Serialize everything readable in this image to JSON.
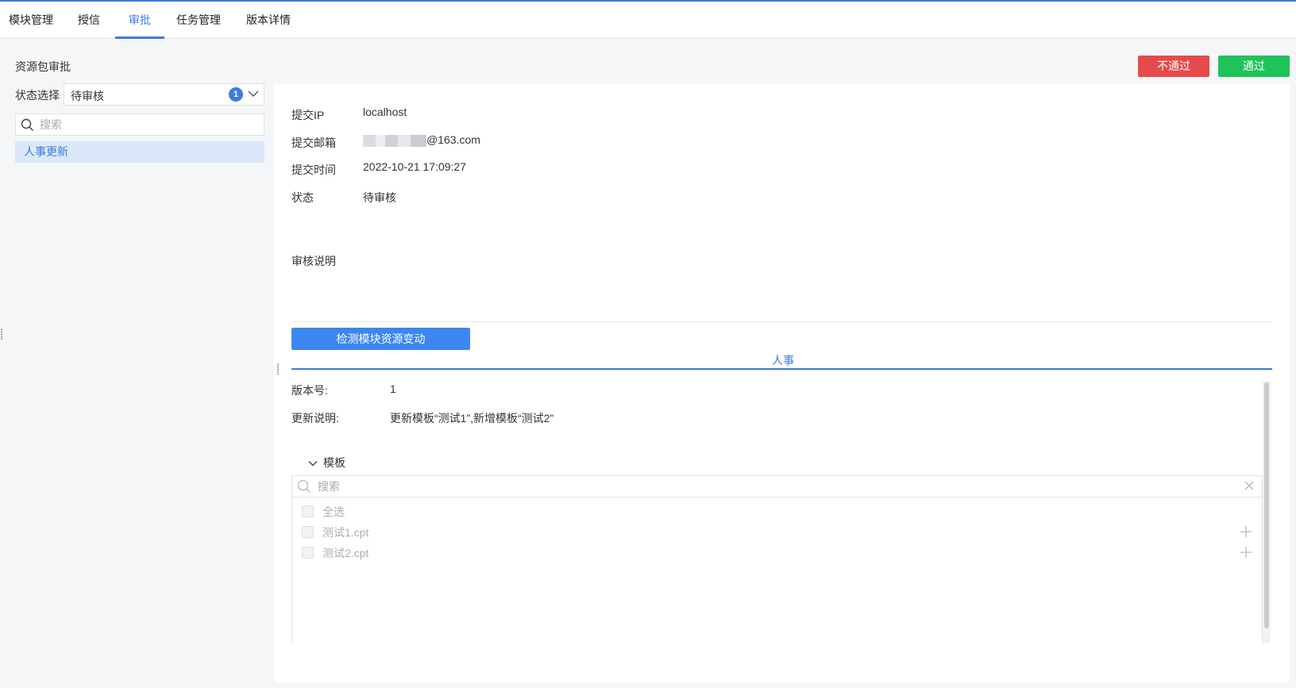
{
  "tabs": [
    {
      "label": "模块管理"
    },
    {
      "label": "授信"
    },
    {
      "label": "审批"
    },
    {
      "label": "任务管理"
    },
    {
      "label": "版本详情"
    }
  ],
  "active_tab": "审批",
  "left": {
    "title": "资源包审批",
    "status_label": "状态选择",
    "status_value": "待审核",
    "status_count": "1",
    "search_placeholder": "搜索",
    "items": [
      "人事更新"
    ]
  },
  "actions": {
    "reject": "不通过",
    "pass": "通过"
  },
  "detail": {
    "ip_label": "提交IP",
    "ip_value": "localhost",
    "email_label": "提交邮箱",
    "email_value": "@163.com",
    "time_label": "提交时间",
    "time_value": "2022-10-21 17:09:27",
    "status_label": "状态",
    "status_value": "待审核",
    "remark_label": "审核说明",
    "check_button": "检测模块资源变动"
  },
  "module": {
    "tab_label": "人事",
    "version_label": "版本号:",
    "version_value": "1",
    "desc_label": "更新说明:",
    "desc_value": "更新模板“测试1”,新增模板“测试2”",
    "template_toggle": "模板",
    "search_placeholder": "搜索",
    "select_all": "全选",
    "templates": [
      "测试1.cpt",
      "测试2.cpt"
    ]
  },
  "colors": {
    "accent": "#3b7ddd",
    "reject": "#e64b4b",
    "pass": "#1fc35a",
    "selected_bg": "#dce8f9"
  }
}
